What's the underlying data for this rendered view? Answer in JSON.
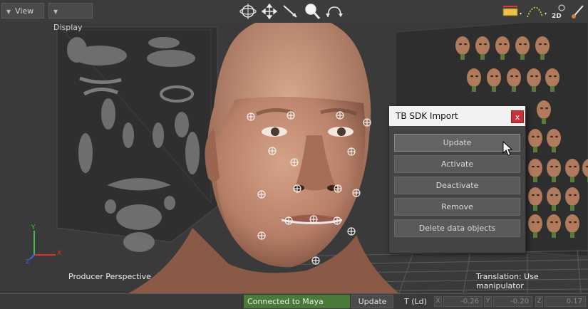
{
  "toolbar": {
    "view_label": "View",
    "display_label": "Display",
    "tools": [
      "orbit-icon",
      "move-icon",
      "pick-icon",
      "zoom-icon",
      "undo-arc-icon"
    ],
    "right_tools": [
      "ruler-icon",
      "curve-icon",
      "2d-icon",
      "brush-icon"
    ],
    "twod_label": "2D"
  },
  "viewport": {
    "camera_label": "Producer Perspective",
    "hint_label": "Translation: Use manipulator",
    "axis_y": "Y",
    "axis_x": "X",
    "axis_z": "Z"
  },
  "dialog": {
    "title": "TB SDK Import",
    "close_label": "x",
    "buttons": [
      "Update",
      "Activate",
      "Deactivate",
      "Remove",
      "Delete data objects"
    ]
  },
  "statusbar": {
    "connection": "Connected to Maya",
    "update_label": "Update",
    "mode_label": "T (Ld)",
    "coords": [
      {
        "axis": "X",
        "value": "-0.26"
      },
      {
        "axis": "Y",
        "value": "-0.20"
      },
      {
        "axis": "Z",
        "value": "0.17"
      }
    ]
  },
  "colors": {
    "connected_green": "#4a7a3a",
    "close_red": "#c8303a",
    "viewport_bg": "#3a3a3a"
  }
}
